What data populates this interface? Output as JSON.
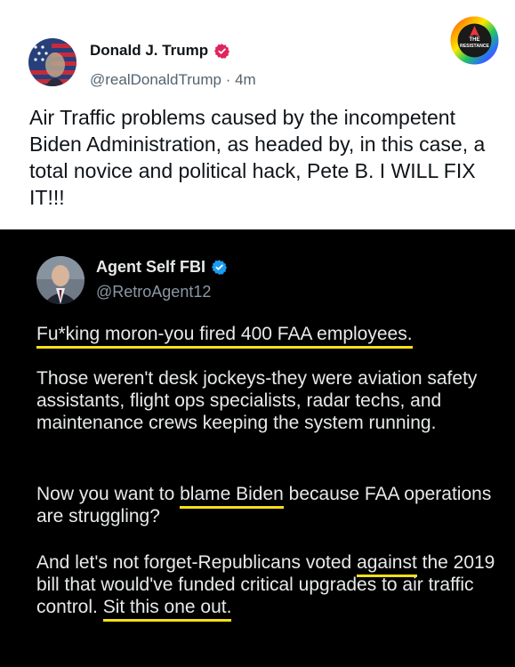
{
  "top_tweet": {
    "name": "Donald J. Trump",
    "handle": "@realDonaldTrump",
    "time": "4m",
    "body": "Air Traffic problems caused by the incompetent Biden Administration, as headed by, in this case, a total novice and political hack, Pete B. I WILL FIX IT!!!",
    "badge_lines": [
      "THE",
      "RESISTANCE"
    ]
  },
  "reply_tweet": {
    "name": "Agent Self FBI",
    "handle": "@RetroAgent12",
    "p1": "Fu*king moron-you fired 400 FAA employees.",
    "p2": "Those weren't desk jockeys-they were aviation safety assistants, flight ops specialists, radar techs, and maintenance crews keeping the system running.",
    "p3_a": "Now you want to ",
    "p3_hl": "blame Biden",
    "p3_b": " because FAA operations are struggling?",
    "p4_a": "And let's not forget-Republicans voted ",
    "p4_hl1": "against",
    "p4_b": " the 2019 bill that would've funded critical upgrades to air traffic control. ",
    "p4_hl2": "Sit this one out."
  },
  "colors": {
    "highlight": "#f4df1a",
    "verified_red": "#e0245e",
    "verified_blue": "#1d9bf0"
  }
}
